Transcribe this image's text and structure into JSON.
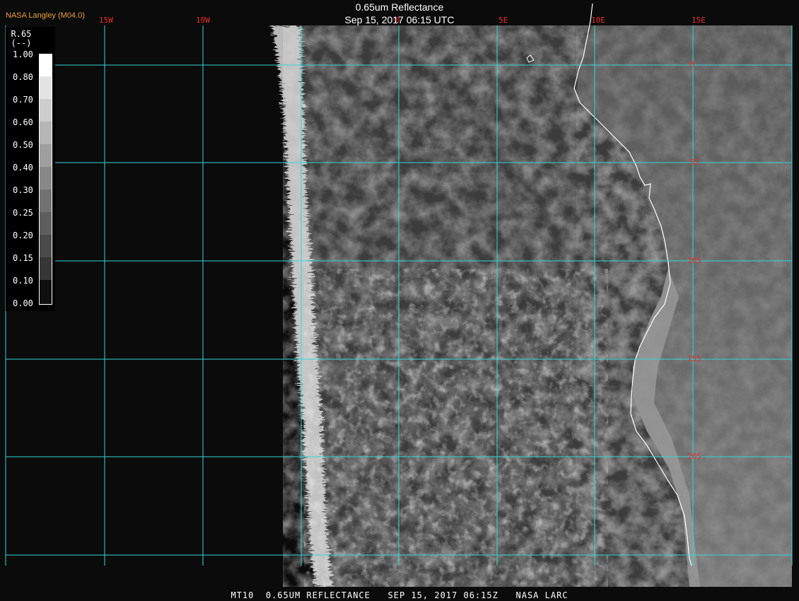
{
  "header": {
    "org": "NASA Langley (M04.0)",
    "title": "0.65um Reflectance",
    "subtitle": "Sep 15, 2017 06:15 UTC"
  },
  "legend": {
    "title": "R.65",
    "unit": "(--)",
    "ticks": [
      "1.00",
      "0.80",
      "0.70",
      "0.60",
      "0.50",
      "0.40",
      "0.30",
      "0.25",
      "0.20",
      "0.15",
      "0.10",
      "0.00"
    ]
  },
  "map": {
    "lon_labels": [
      "15W",
      "10W",
      "0",
      "5E",
      "10E",
      "15E"
    ],
    "lat_labels": [
      "0",
      "5S",
      "10S",
      "15S",
      "20S"
    ],
    "grid_color": "#33d6d6",
    "label_color": "#e53030",
    "coast_color": "#ffffff",
    "space_color": "#0b0b0b"
  },
  "footer": {
    "text": "MT10  0.65UM REFLECTANCE   SEP 15, 2017 06:15Z   NASA LARC"
  }
}
